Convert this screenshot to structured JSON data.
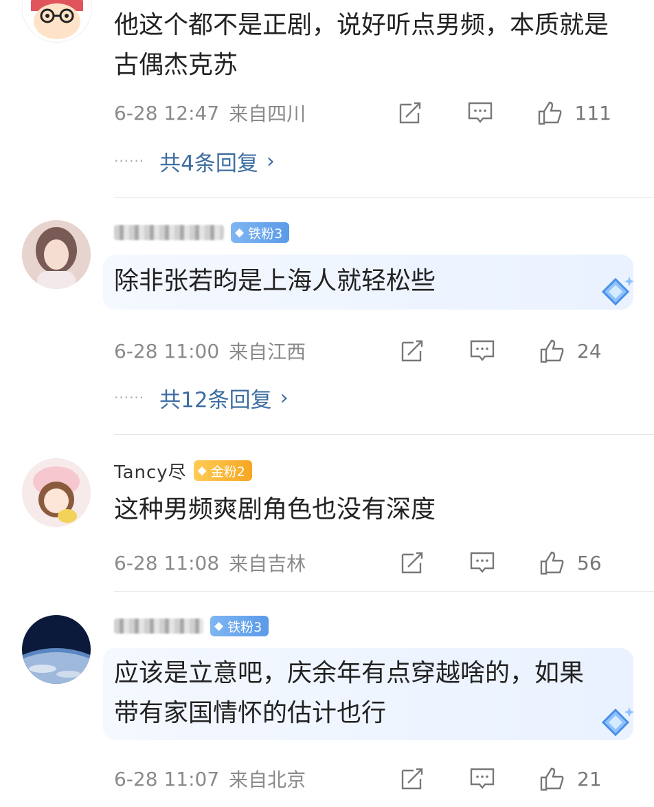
{
  "comments": [
    {
      "name": "",
      "badge": "",
      "text": "他这个都不是正剧，说好听点男频，本质就是古偶杰克苏",
      "time": "6-28 12:47",
      "location": "来自四川",
      "likes": "111",
      "replies": "共4条回复"
    },
    {
      "name": "",
      "badge": "铁粉3",
      "text": "除非张若昀是上海人就轻松些",
      "time": "6-28 11:00",
      "location": "来自江西",
      "likes": "24",
      "replies": "共12条回复"
    },
    {
      "name": "Tancy尽",
      "badge": "金粉2",
      "text": "这种男频爽剧角色也没有深度",
      "time": "6-28 11:08",
      "location": "来自吉林",
      "likes": "56",
      "replies": ""
    },
    {
      "name": "",
      "badge": "铁粉3",
      "text": "应该是立意吧，庆余年有点穿越啥的，如果带有家国情怀的估计也行",
      "time": "6-28 11:07",
      "location": "来自北京",
      "likes": "21",
      "replies": ""
    }
  ],
  "icons": {
    "share": "share-icon",
    "reply": "comment-icon",
    "like": "thumbs-up-icon",
    "badge_gem": "diamond-icon"
  },
  "colors": {
    "link": "#3e6ea1",
    "meta": "#8a8a8a",
    "iron_badge": "#5a9ae8",
    "gold_badge": "#f5a623"
  }
}
